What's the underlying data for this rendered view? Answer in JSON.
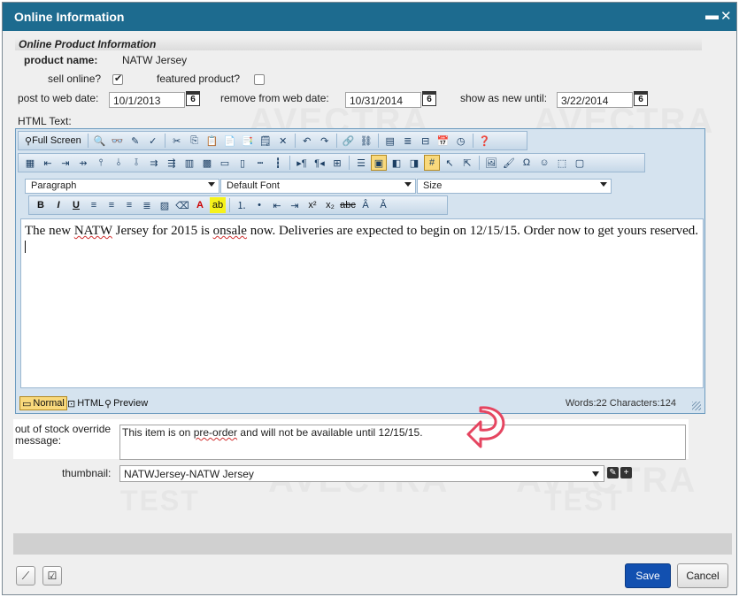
{
  "dialog": {
    "title": "Online Information",
    "minimize_glyph": "▬",
    "close_glyph": "✕"
  },
  "watermarks": {
    "brand": "AVECTRA",
    "mark": "TEST"
  },
  "section": {
    "title": "Online Product Information"
  },
  "product": {
    "name_label": "product name:",
    "name_value": "NATW Jersey",
    "sell_online_label": "sell online?",
    "sell_online": true,
    "featured_label": "featured product?",
    "featured": false
  },
  "dates": {
    "post_label": "post to web date:",
    "post_value": "10/1/2013",
    "remove_label": "remove from web date:",
    "remove_value": "10/31/2014",
    "show_new_label": "show as new until:",
    "show_new_value": "3/22/2014",
    "cal_glyph": "6"
  },
  "html_text": {
    "label": "HTML Text:",
    "toolbar": {
      "full_screen": "Full Screen",
      "paragraph": "Paragraph",
      "font": "Default Font",
      "size": "Size"
    },
    "content_parts": {
      "p1": "The new ",
      "p2": "NATW",
      "p3": " Jersey for 2015 is ",
      "p4": "onsale",
      "p5": " now.  Deliveries are expected to begin on 12/15/15.  Order now to get yours reserved."
    },
    "modes": {
      "normal": "Normal",
      "html": "HTML",
      "preview": "Preview"
    },
    "stats": "Words:22 Characters:124"
  },
  "out_of_stock": {
    "label": "out of stock override message:",
    "value_parts": {
      "a": "This item is on ",
      "b": "pre-order",
      "c": " and will not be available until 12/15/15."
    }
  },
  "thumbnail": {
    "label": "thumbnail:",
    "value": "NATWJersey-NATW Jersey"
  },
  "footer": {
    "save": "Save",
    "cancel": "Cancel"
  },
  "colors": {
    "title_bar": "#1d6b8f",
    "save_button": "#1250b0",
    "annotation_arrow": "#e54560"
  }
}
